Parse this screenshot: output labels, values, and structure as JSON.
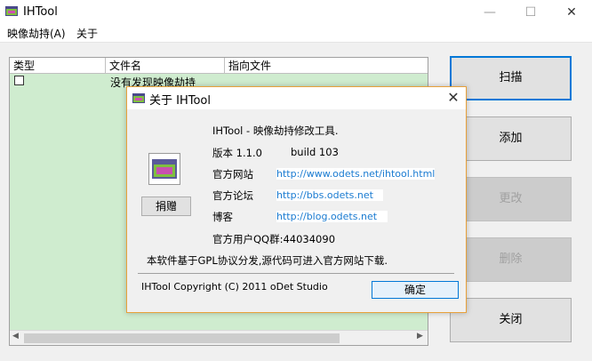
{
  "window": {
    "title": "IHTool"
  },
  "menu": {
    "items": [
      "映像劫持(A)",
      "关于"
    ]
  },
  "list": {
    "columns": [
      "类型",
      "文件名",
      "指向文件"
    ],
    "rows": [
      {
        "type_checked": false,
        "filename": "没有发现映像劫持",
        "target": ""
      }
    ]
  },
  "buttons": {
    "scan": "扫描",
    "add": "添加",
    "change": "更改",
    "delete": "删除",
    "close": "关闭"
  },
  "dialog": {
    "title": "关于 IHTool",
    "heading": "IHTool - 映像劫持修改工具.",
    "version_label": "版本 1.1.0",
    "build": "build 103",
    "site_label": "官方网站",
    "site_url": "http://www.odets.net/ihtool.html",
    "forum_label": "官方论坛",
    "forum_url": "http://bbs.odets.net",
    "blog_label": "博客",
    "blog_url": "http://blog.odets.net",
    "qq_group": "官方用户QQ群:44034090",
    "license": "本软件基于GPL协议分发,源代码可进入官方网站下载.",
    "copyright": "IHTool Copyright (C) 2011 oDet Studio",
    "donate": "捐赠",
    "ok": "确定"
  },
  "icons": {
    "app": "app-window-icon",
    "dialog": "app-window-icon",
    "logo": "ihtool-logo-icon"
  },
  "colors": {
    "list_bg": "#cfeccf",
    "focus_border": "#0078d7",
    "dialog_border": "#e8a13a",
    "link": "#1a7bd1"
  }
}
